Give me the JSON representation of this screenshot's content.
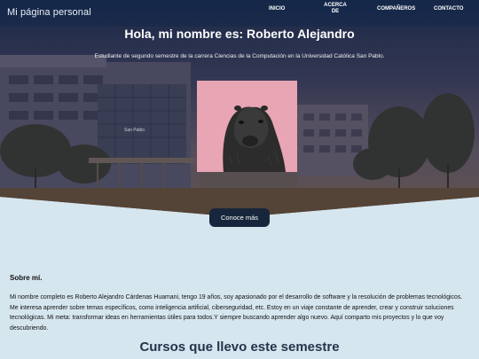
{
  "header": {
    "site_title": "Mi página personal",
    "nav": [
      "INICIO",
      "ACERCA DE",
      "COMPAÑEROS",
      "CONTACTO"
    ]
  },
  "hero": {
    "heading": "Hola, mi nombre es: Roberto Alejandro",
    "subtitle": "Estudiante de segundo semestre de la carrera Ciencias de la Computación en la Universidad Católica San Pablo.",
    "building_sign": "San Pablo",
    "cta_label": "Conoce más"
  },
  "about": {
    "title": "Sobre mí.",
    "text": "Mi nombre completo es Roberto Alejandro Cárdenas Huamani, tengo 19 años, soy apasionado por el desarrollo de software y la resolución de problemas tecnológicos. Me interesa aprender sobre temas específicos, como inteligencia artificial, ciberseguridad, etc. Estoy en un viaje constante de aprender, crear y construir soluciones tecnológicas. Mi meta: transformar ideas en herramientas útiles para todos.Y siempre buscando aprender algo nuevo. Aquí comparto mis proyectos y lo que voy descubriendo."
  },
  "courses": {
    "title": "Cursos que llevo este semestre"
  },
  "colors": {
    "page_bg": "#d6e6ef",
    "nav_bg": "#1c2f4d",
    "button_bg": "#17263b",
    "photo_bg": "#e8a5b4",
    "heading_dark": "#27334a"
  }
}
